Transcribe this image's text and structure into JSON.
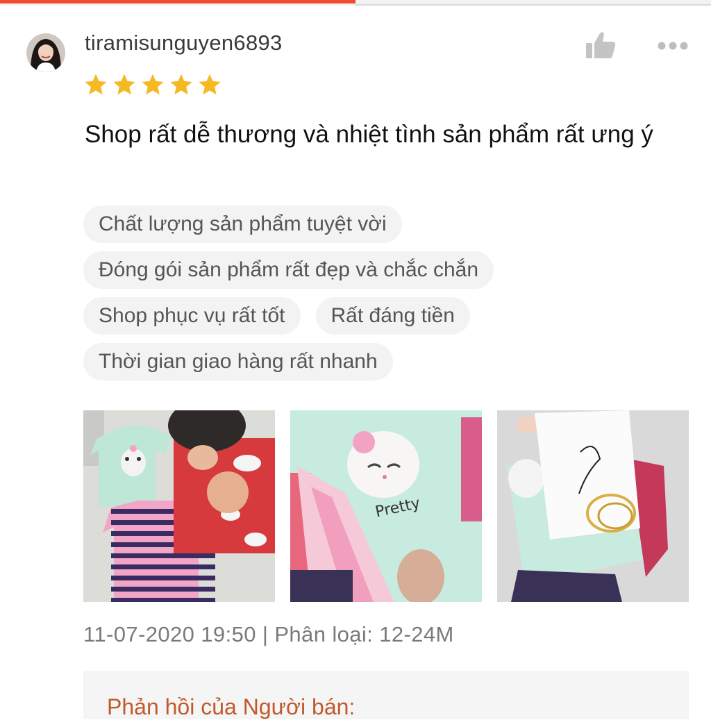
{
  "progress": {
    "fraction": 0.5,
    "color": "#ee4d2d"
  },
  "review": {
    "username": "tiramisunguyen6893",
    "rating": 5,
    "rating_max": 5,
    "star_color": "#f5b921",
    "text": "Shop rất dễ thương và nhiệt tình sản phẩm rất ưng ý",
    "tags": [
      "Chất lượng sản phẩm tuyệt vời",
      "Đóng gói sản phẩm rất đẹp và chắc chắn",
      "Shop phục vụ rất tốt",
      "Rất đáng tiền",
      "Thời gian giao hàng rất nhanh"
    ],
    "meta": "11-07-2020 19:50 | Phân loại: 12-24M",
    "seller_reply_title": "Phản hồi của Người bán:"
  },
  "icons": {
    "avatar": "user-avatar",
    "like": "thumbs-up-icon",
    "more": "more-options-icon",
    "star": "star-icon"
  },
  "photo_content": {
    "photo2_print": "Pretty"
  }
}
